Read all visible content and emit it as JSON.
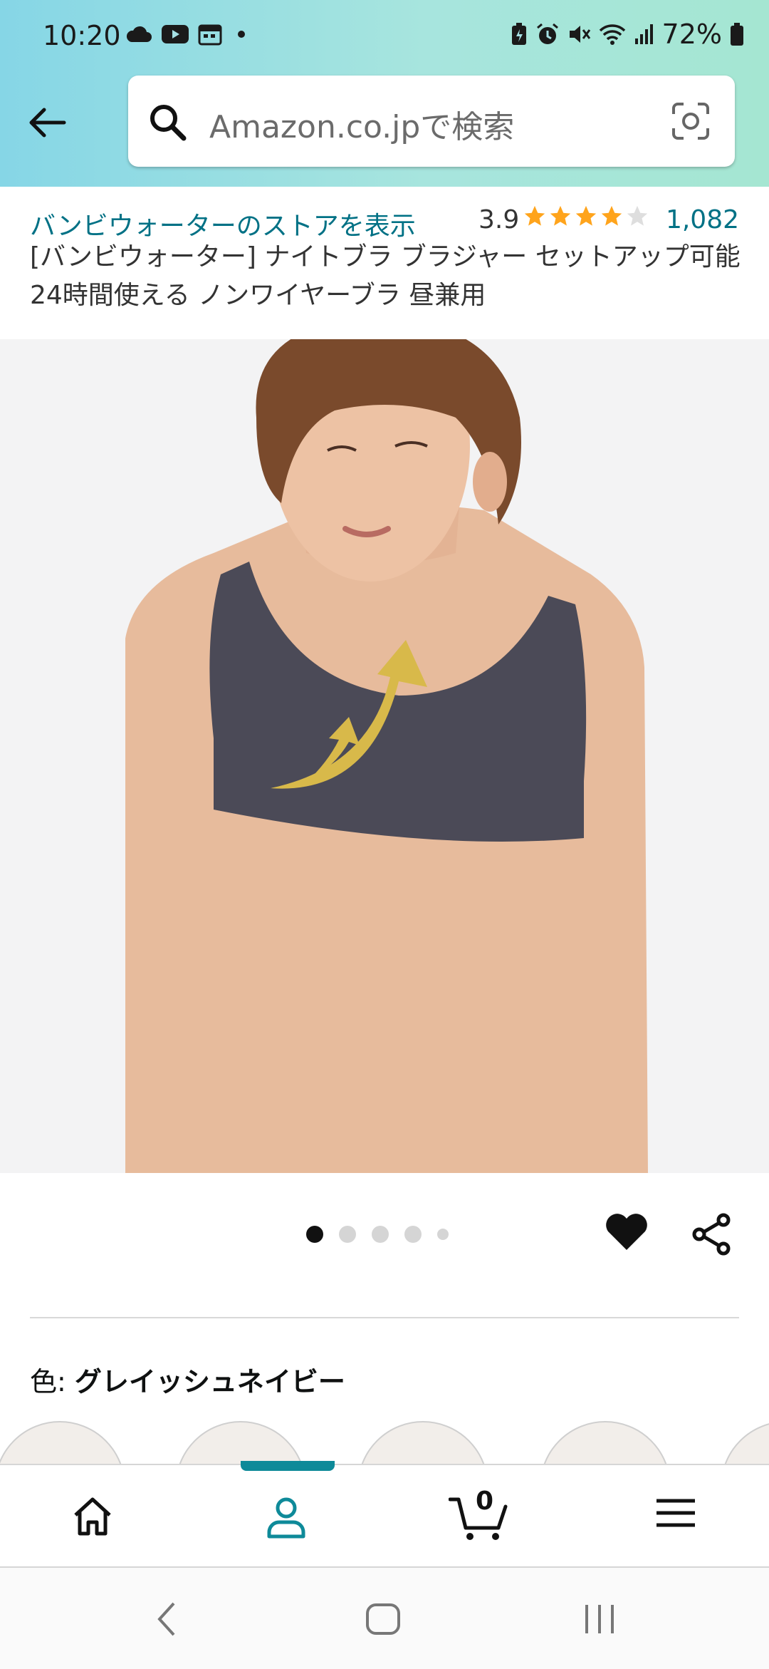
{
  "status_bar": {
    "time": "10:20",
    "battery": "72%",
    "left_icons": [
      "cloud-icon",
      "youtube-icon",
      "calendar-icon",
      "dot-icon"
    ],
    "right_icons": [
      "battery-saver-icon",
      "alarm-icon",
      "mute-icon",
      "wifi-icon",
      "signal-icon",
      "battery-icon"
    ]
  },
  "header": {
    "search_placeholder": "Amazon.co.jpで検索"
  },
  "product": {
    "store_link": "バンビウォーターのストアを表示",
    "rating": "3.9",
    "rating_value": 3.9,
    "rating_count": "1,082",
    "title": "[バンビウォーター] ナイトブラ ブラジャー セットアップ可能 24時間使える ノンワイヤーブラ 昼兼用"
  },
  "gallery": {
    "image_count": 5,
    "active_index": 0
  },
  "variation": {
    "label": "色: ",
    "value": "グレイッシュネイビー"
  },
  "bottom_nav": {
    "items": [
      "home-icon",
      "account-icon",
      "cart-icon",
      "menu-icon"
    ],
    "active": "account-icon",
    "cart_count": "0"
  },
  "colors": {
    "accent_teal": "#0e8a99",
    "link": "#007185",
    "star": "#FFA41C",
    "bra": "#4b4a57"
  }
}
